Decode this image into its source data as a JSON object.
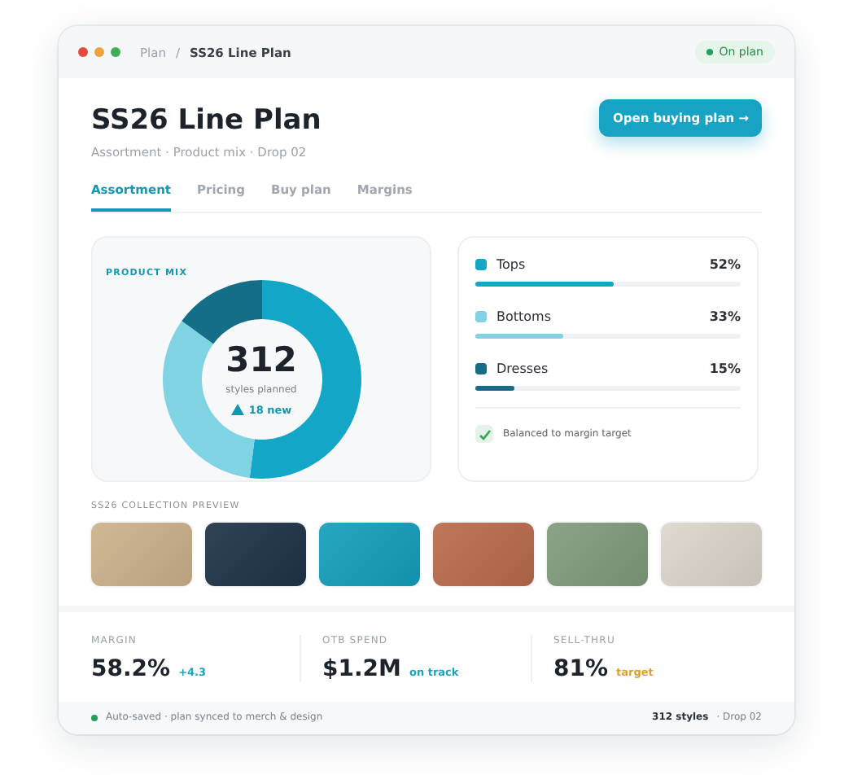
{
  "window": {
    "breadcrumb": [
      "Plan",
      "SS26 Line Plan"
    ],
    "breadcrumb_separator": "/",
    "status": {
      "label": "On plan",
      "color": "#22a05a"
    }
  },
  "header": {
    "title": "SS26 Line Plan",
    "subtitle": "Assortment · Product mix · Drop 02",
    "action": "Open buying plan →"
  },
  "tabs": [
    {
      "label": "Assortment",
      "selected": true
    },
    {
      "label": "Pricing",
      "selected": false
    },
    {
      "label": "Buy plan",
      "selected": false
    },
    {
      "label": "Margins",
      "selected": false
    }
  ],
  "product_mix": {
    "title": "PRODUCT MIX",
    "total": "312",
    "total_label": "styles planned",
    "trend": "18 new"
  },
  "mix_legend": [
    {
      "name": "Tops",
      "reading": "52%",
      "level": 0.52,
      "color": "#14a6c6"
    },
    {
      "name": "Bottoms",
      "reading": "33%",
      "level": 0.33,
      "color": "#7fd3e2"
    },
    {
      "name": "Dresses",
      "reading": "15%",
      "level": 0.15,
      "color": "#146e88"
    }
  ],
  "balance_note": {
    "label": "Balanced to margin target",
    "checked": true
  },
  "collection": {
    "title": "SS26 COLLECTION PREVIEW",
    "swatches": [
      {
        "color": "#cdb28c"
      },
      {
        "color": "#1f3448"
      },
      {
        "color": "#159fbd"
      },
      {
        "color": "#ba6c4c"
      },
      {
        "color": "#819c7c"
      },
      {
        "color": "#ddd7cc"
      }
    ]
  },
  "kpis": [
    {
      "label": "MARGIN",
      "value": "58.2%",
      "note": "+4.3",
      "color": "#1aa3c2"
    },
    {
      "label": "OTB SPEND",
      "value": "$1.2M",
      "note": "on track",
      "color": "#1aa3c2"
    },
    {
      "label": "SELL-THRU",
      "value": "81%",
      "note": "target",
      "color": "#e0a030"
    }
  ],
  "footer": {
    "status": {
      "label": "Auto-saved · plan synced to merch & design",
      "color": "#22a05a"
    },
    "count": "312 styles",
    "drop": "· Drop 02"
  }
}
